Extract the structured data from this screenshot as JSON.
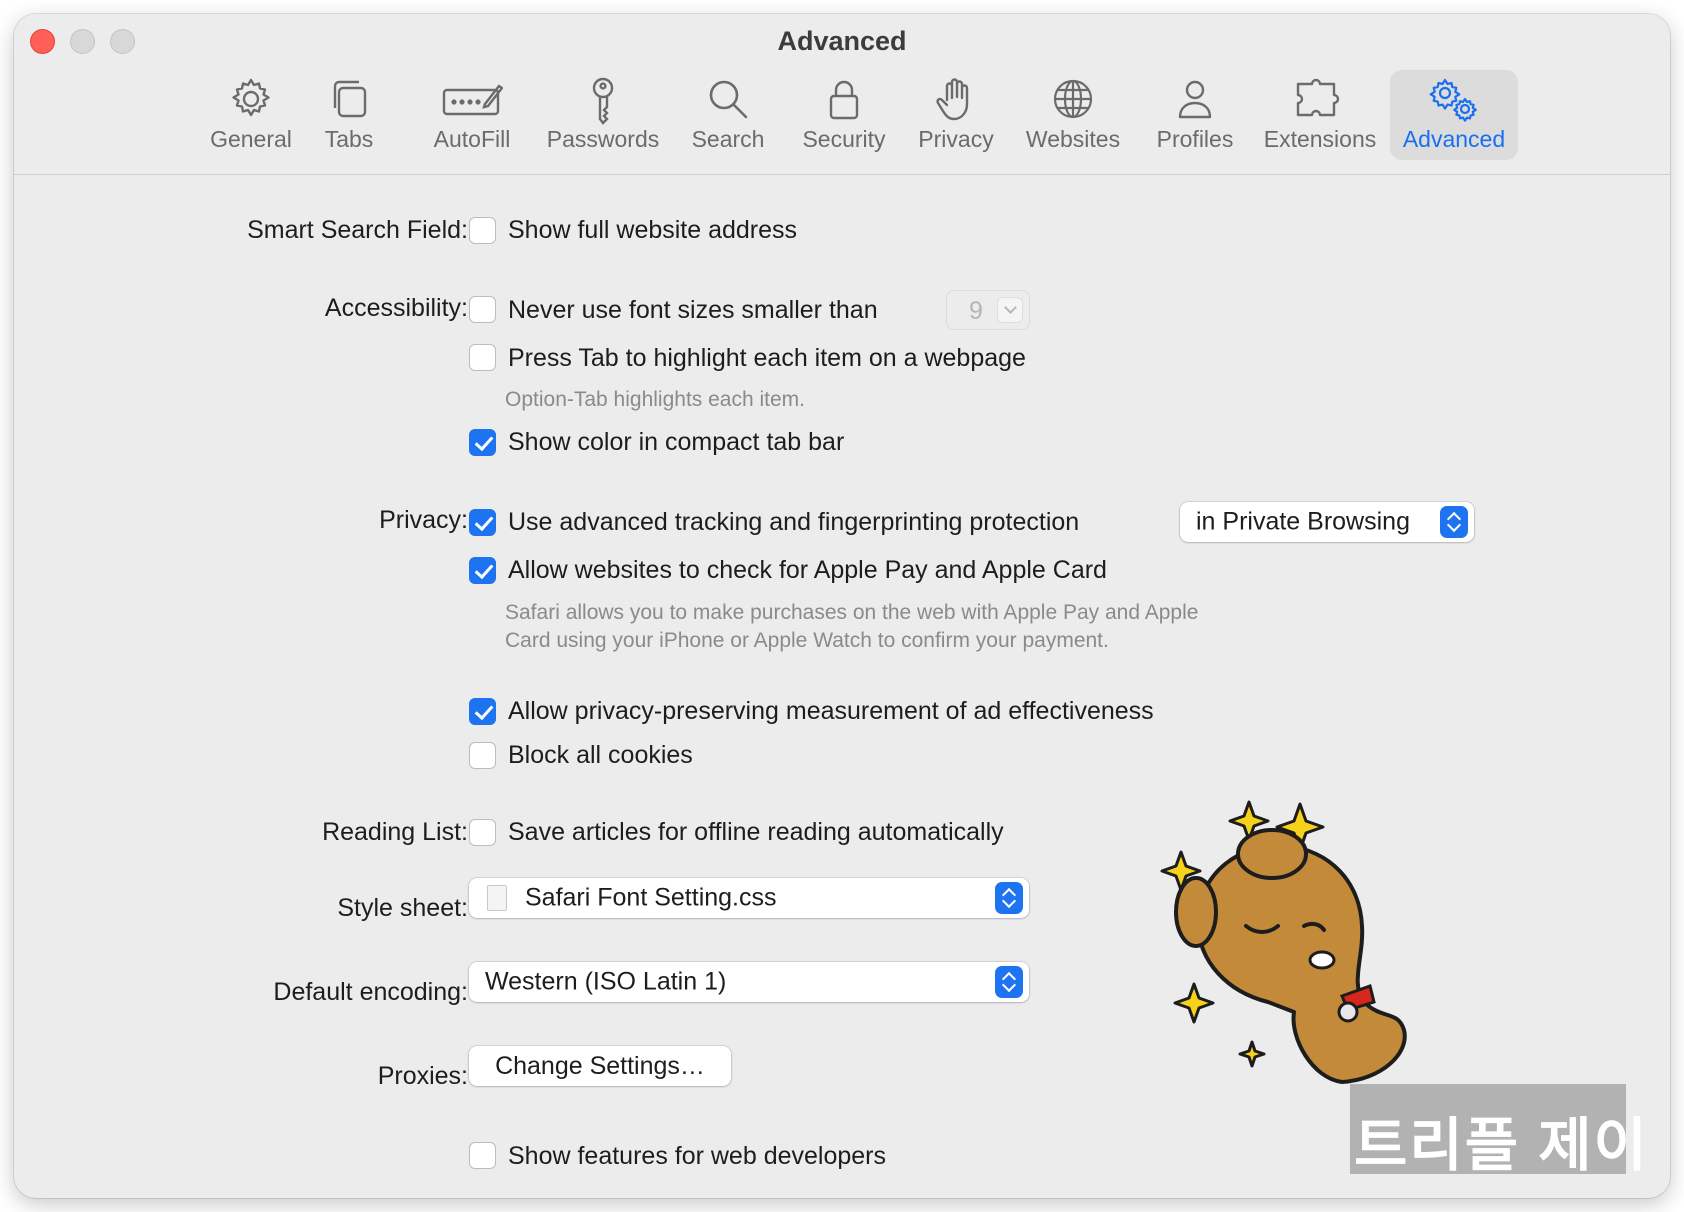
{
  "window": {
    "title": "Advanced"
  },
  "toolbar": {
    "items": [
      {
        "label": "General",
        "icon": "gear-icon"
      },
      {
        "label": "Tabs",
        "icon": "tabs-icon"
      },
      {
        "label": "AutoFill",
        "icon": "autofill-icon"
      },
      {
        "label": "Passwords",
        "icon": "key-icon"
      },
      {
        "label": "Search",
        "icon": "search-icon"
      },
      {
        "label": "Security",
        "icon": "lock-icon"
      },
      {
        "label": "Privacy",
        "icon": "hand-icon"
      },
      {
        "label": "Websites",
        "icon": "globe-icon"
      },
      {
        "label": "Profiles",
        "icon": "person-icon"
      },
      {
        "label": "Extensions",
        "icon": "puzzle-icon"
      },
      {
        "label": "Advanced",
        "icon": "gears-icon",
        "selected": true
      }
    ]
  },
  "smart_search": {
    "label": "Smart Search Field:",
    "show_full_address": {
      "label": "Show full website address",
      "checked": false
    }
  },
  "accessibility": {
    "label": "Accessibility:",
    "min_font": {
      "label": "Never use font sizes smaller than",
      "checked": false,
      "value": "9"
    },
    "press_tab": {
      "label": "Press Tab to highlight each item on a webpage",
      "checked": false
    },
    "press_tab_hint": "Option-Tab highlights each item.",
    "compact_color": {
      "label": "Show color in compact tab bar",
      "checked": true
    }
  },
  "privacy": {
    "label": "Privacy:",
    "tracking": {
      "label": "Use advanced tracking and fingerprinting protection",
      "checked": true,
      "mode": "in Private Browsing"
    },
    "apple_pay": {
      "label": "Allow websites to check for Apple Pay and Apple Card",
      "checked": true
    },
    "apple_pay_hint": "Safari allows you to make purchases on the web with Apple Pay and Apple Card using your iPhone or Apple Watch to confirm your payment.",
    "ad_measurement": {
      "label": "Allow privacy-preserving measurement of ad effectiveness",
      "checked": true
    },
    "block_cookies": {
      "label": "Block all cookies",
      "checked": false
    }
  },
  "reading_list": {
    "label": "Reading List:",
    "offline": {
      "label": "Save articles for offline reading automatically",
      "checked": false
    }
  },
  "style_sheet": {
    "label": "Style sheet:",
    "value": "Safari Font Setting.css"
  },
  "encoding": {
    "label": "Default encoding:",
    "value": "Western (ISO Latin 1)"
  },
  "proxies": {
    "label": "Proxies:",
    "button": "Change Settings…"
  },
  "developer": {
    "label": "Show features for web developers",
    "checked": false
  },
  "overlay": {
    "watermark_text": "트리플 제이"
  },
  "colors": {
    "accent": "#1e74f0",
    "close": "#fe5f57",
    "background": "#ececec"
  }
}
